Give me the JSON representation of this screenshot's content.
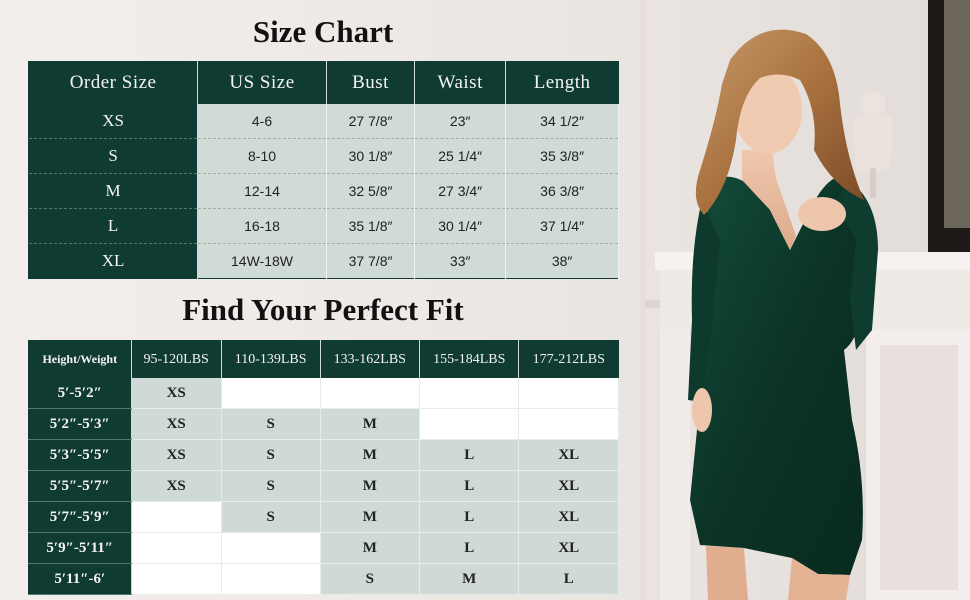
{
  "size_chart": {
    "title": "Size Chart",
    "headers": [
      "Order Size",
      "US Size",
      "Bust",
      "Waist",
      "Length"
    ],
    "rows": [
      [
        "XS",
        "4-6",
        "27 7/8″",
        "23″",
        "34 1/2″"
      ],
      [
        "S",
        "8-10",
        "30 1/8″",
        "25 1/4″",
        "35 3/8″"
      ],
      [
        "M",
        "12-14",
        "32 5/8″",
        "27 3/4″",
        "36 3/8″"
      ],
      [
        "L",
        "16-18",
        "35 1/8″",
        "30 1/4″",
        "37 1/4″"
      ],
      [
        "XL",
        "14W-18W",
        "37 7/8″",
        "33″",
        "38″"
      ]
    ]
  },
  "fit_chart": {
    "title": "Find Your Perfect Fit",
    "corner_label": "Height/Weight",
    "weights": [
      "95-120LBS",
      "110-139LBS",
      "133-162LBS",
      "155-184LBS",
      "177-212LBS"
    ],
    "rows": [
      {
        "height": "5′-5′2″",
        "sizes": [
          "XS",
          "",
          "",
          "",
          ""
        ]
      },
      {
        "height": "5′2″-5′3″",
        "sizes": [
          "XS",
          "S",
          "M",
          "",
          ""
        ]
      },
      {
        "height": "5′3″-5′5″",
        "sizes": [
          "XS",
          "S",
          "M",
          "L",
          "XL"
        ]
      },
      {
        "height": "5′5″-5′7″",
        "sizes": [
          "XS",
          "S",
          "M",
          "L",
          "XL"
        ]
      },
      {
        "height": "5′7″-5′9″",
        "sizes": [
          "",
          "S",
          "M",
          "L",
          "XL"
        ]
      },
      {
        "height": "5′9″-5′11″",
        "sizes": [
          "",
          "",
          "M",
          "L",
          "XL"
        ]
      },
      {
        "height": "5′11″-6′",
        "sizes": [
          "",
          "",
          "S",
          "M",
          "L"
        ]
      }
    ]
  },
  "colors": {
    "header_green": "#0f3b33",
    "cell_gray_green": "#d0dbd7",
    "dress_green": "#0d3a2c",
    "background": "#f1ecea"
  }
}
